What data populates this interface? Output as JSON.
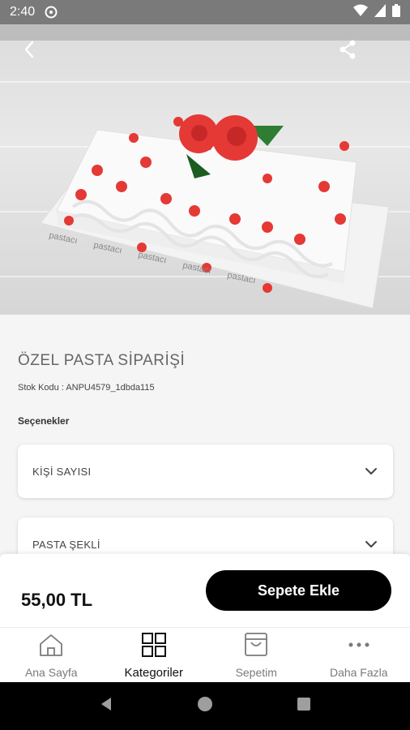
{
  "status_bar": {
    "time": "2:40"
  },
  "product": {
    "title": "ÖZEL PASTA SİPARİŞİ",
    "sku": "Stok Kodu : ANPU4579_1dbda115",
    "options_label": "Seçenekler",
    "options": [
      {
        "label": "KİŞİ SAYISI"
      },
      {
        "label": "PASTA ŞEKLİ"
      }
    ],
    "image_brand_text": "pastacı"
  },
  "cart": {
    "price": "55,00 TL",
    "add_button_label": "Sepete Ekle"
  },
  "bottom_nav": {
    "items": [
      {
        "label": "Ana Sayfa",
        "icon": "home-icon",
        "active": false
      },
      {
        "label": "Kategoriler",
        "icon": "grid-icon",
        "active": true
      },
      {
        "label": "Sepetim",
        "icon": "bag-icon",
        "active": false
      },
      {
        "label": "Daha Fazla",
        "icon": "more-icon",
        "active": false
      }
    ]
  },
  "colors": {
    "accent": "#000000",
    "status_bar": "#7a7a7a",
    "cake_hearts": "#e53935"
  }
}
